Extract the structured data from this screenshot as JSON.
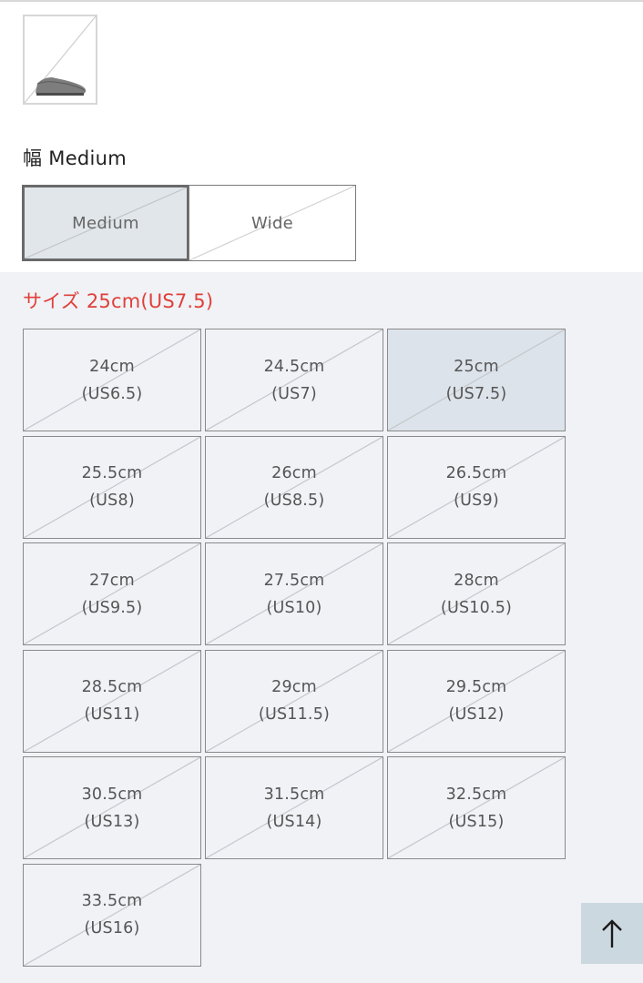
{
  "color": {
    "thumbnail_icon": "dress-shoe-thumbnail"
  },
  "width": {
    "heading": "幅 Medium",
    "options": [
      {
        "label": "Medium",
        "selected": true
      },
      {
        "label": "Wide",
        "selected": false
      }
    ]
  },
  "size": {
    "heading": "サイズ 25cm(US7.5)",
    "heading_color": "#e0403a",
    "options": [
      {
        "cm": "24cm",
        "us": "(US6.5)",
        "selected": false
      },
      {
        "cm": "24.5cm",
        "us": "(US7)",
        "selected": false
      },
      {
        "cm": "25cm",
        "us": "(US7.5)",
        "selected": true
      },
      {
        "cm": "25.5cm",
        "us": "(US8)",
        "selected": false
      },
      {
        "cm": "26cm",
        "us": "(US8.5)",
        "selected": false
      },
      {
        "cm": "26.5cm",
        "us": "(US9)",
        "selected": false
      },
      {
        "cm": "27cm",
        "us": "(US9.5)",
        "selected": false
      },
      {
        "cm": "27.5cm",
        "us": "(US10)",
        "selected": false
      },
      {
        "cm": "28cm",
        "us": "(US10.5)",
        "selected": false
      },
      {
        "cm": "28.5cm",
        "us": "(US11)",
        "selected": false
      },
      {
        "cm": "29cm",
        "us": "(US11.5)",
        "selected": false
      },
      {
        "cm": "29.5cm",
        "us": "(US12)",
        "selected": false
      },
      {
        "cm": "30.5cm",
        "us": "(US13)",
        "selected": false
      },
      {
        "cm": "31.5cm",
        "us": "(US14)",
        "selected": false
      },
      {
        "cm": "32.5cm",
        "us": "(US15)",
        "selected": false
      },
      {
        "cm": "33.5cm",
        "us": "(US16)",
        "selected": false
      }
    ]
  },
  "back_to_top": {
    "icon": "arrow-up-icon",
    "background": "#cbd8e0"
  }
}
